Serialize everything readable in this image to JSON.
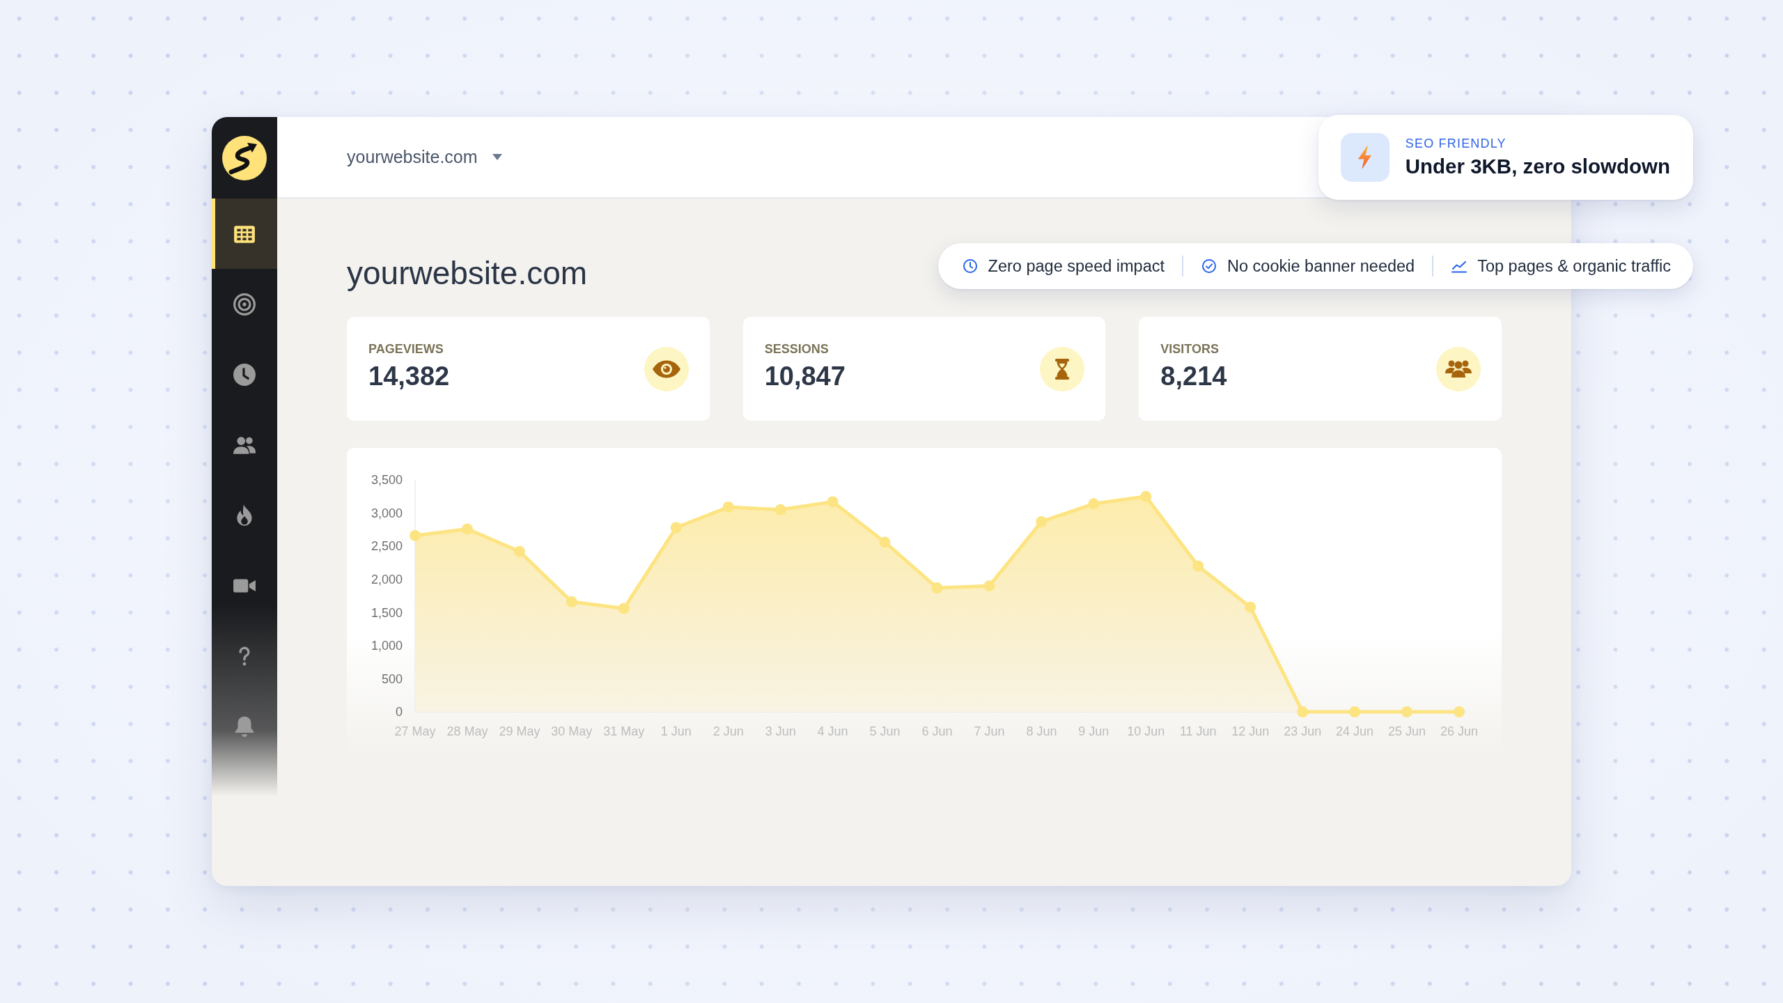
{
  "sidebar": {
    "items": [
      {
        "selected": true
      },
      {
        "selected": false
      },
      {
        "selected": false
      },
      {
        "selected": false
      },
      {
        "selected": false
      },
      {
        "selected": false
      },
      {
        "selected": false
      },
      {
        "selected": false
      }
    ]
  },
  "header": {
    "site_selector": {
      "value": "yourwebsite.com"
    }
  },
  "seo_callout": {
    "eyebrow": "SEO FRIENDLY",
    "headline": "Under 3KB, zero slowdown"
  },
  "page_title": "yourwebsite.com",
  "features": [
    "Zero page speed impact",
    "No cookie banner needed",
    "Top pages & organic traffic"
  ],
  "stats": [
    {
      "label": "PAGEVIEWS",
      "value": "14,382"
    },
    {
      "label": "SESSIONS",
      "value": "10,847"
    },
    {
      "label": "VISITORS",
      "value": "8,214"
    }
  ],
  "traffic_chart": {
    "chart_data": {
      "type": "area",
      "categories": [
        "27 May",
        "28 May",
        "29 May",
        "30 May",
        "31 May",
        "1 Jun",
        "2 Jun",
        "3 Jun",
        "4 Jun",
        "5 Jun",
        "6 Jun",
        "7 Jun",
        "8 Jun",
        "9 Jun",
        "10 Jun",
        "11 Jun",
        "12 Jun",
        "23 Jun",
        "24 Jun",
        "25 Jun",
        "26 Jun"
      ],
      "values": [
        2660,
        2760,
        2420,
        1660,
        1560,
        2780,
        3090,
        3050,
        3170,
        2560,
        1870,
        1900,
        2870,
        3140,
        3250,
        2200,
        1580,
        0,
        0,
        0,
        0
      ],
      "ylim": [
        0,
        3500
      ],
      "yticks": [
        {
          "value": 0,
          "label": "0"
        },
        {
          "value": 500,
          "label": "500"
        },
        {
          "value": 1000,
          "label": "1,000"
        },
        {
          "value": 1500,
          "label": "1,500"
        },
        {
          "value": 2000,
          "label": "2,000"
        },
        {
          "value": 2500,
          "label": "2,500"
        },
        {
          "value": 3000,
          "label": "3,000"
        },
        {
          "value": 3500,
          "label": "3,500"
        }
      ]
    }
  }
}
